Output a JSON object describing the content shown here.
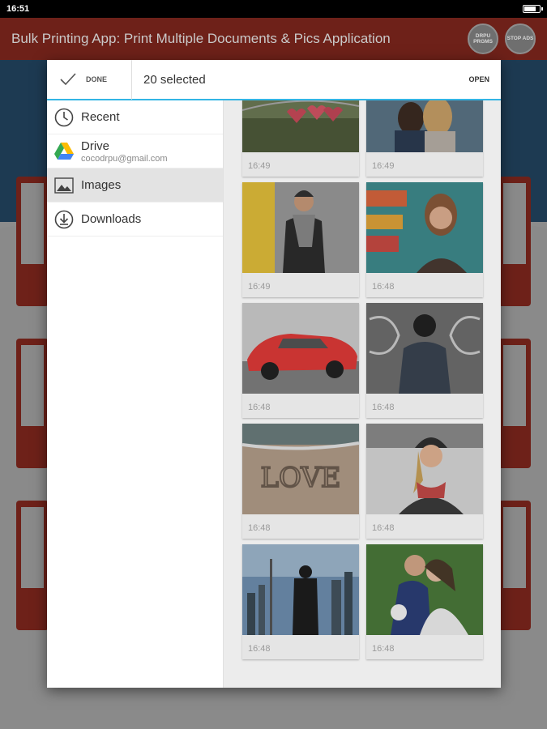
{
  "status_bar": {
    "time": "16:51"
  },
  "app": {
    "title": "Bulk Printing App: Print Multiple Documents & Pics Application",
    "buttons": [
      "DRPU PRGMS",
      "STOP ADS"
    ]
  },
  "picker": {
    "done_label": "DONE",
    "selected_text": "20 selected",
    "open_label": "OPEN",
    "sidebar": [
      {
        "label": "Recent",
        "icon": "clock-icon",
        "active": false
      },
      {
        "label": "Drive",
        "sub": "cocodrpu@gmail.com",
        "icon": "drive-icon",
        "active": false
      },
      {
        "label": "Images",
        "icon": "image-icon",
        "active": true
      },
      {
        "label": "Downloads",
        "icon": "download-icon",
        "active": false
      }
    ],
    "thumbnails": [
      {
        "time": "16:49",
        "subject": "red heart padlocks"
      },
      {
        "time": "16:49",
        "subject": "couple by the sea"
      },
      {
        "time": "16:49",
        "subject": "man in beanie and scarf"
      },
      {
        "time": "16:48",
        "subject": "woman with colorful wall"
      },
      {
        "time": "16:48",
        "subject": "red sports car"
      },
      {
        "time": "16:48",
        "subject": "man in hoodie with graffiti"
      },
      {
        "time": "16:48",
        "subject": "love written in sand"
      },
      {
        "time": "16:48",
        "subject": "smiling woman in beanie"
      },
      {
        "time": "16:48",
        "subject": "man facing city skyline"
      },
      {
        "time": "16:48",
        "subject": "wedding couple"
      }
    ]
  },
  "colors": {
    "accent": "#33b5e5",
    "app_bar": "#6e2119",
    "active_item": "#e3e3e3"
  }
}
